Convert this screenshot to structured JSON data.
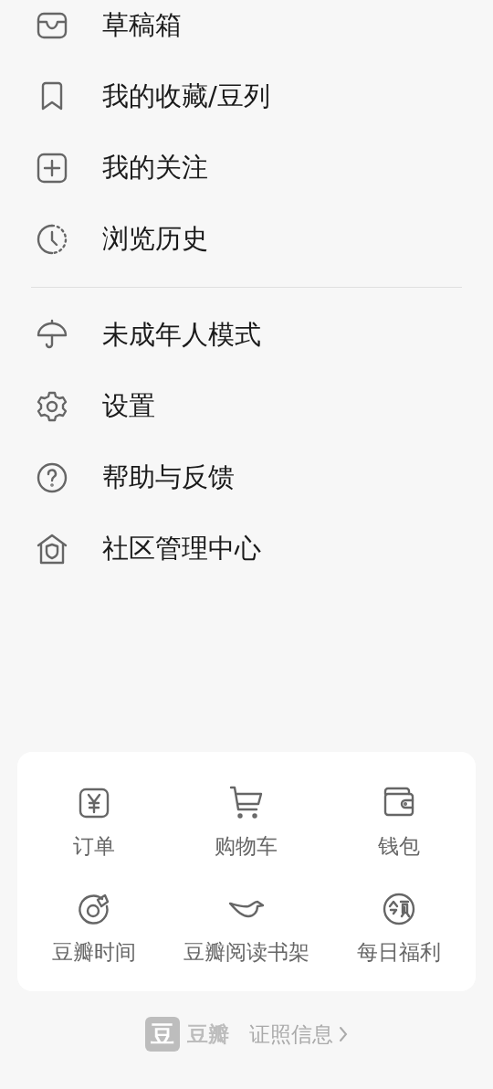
{
  "menu_groups": [
    {
      "items": [
        {
          "label": "草稿箱"
        },
        {
          "label": "我的收藏/豆列"
        },
        {
          "label": "我的关注"
        },
        {
          "label": "浏览历史"
        }
      ]
    },
    {
      "items": [
        {
          "label": "未成年人模式"
        },
        {
          "label": "设置"
        },
        {
          "label": "帮助与反馈"
        },
        {
          "label": "社区管理中心"
        }
      ]
    }
  ],
  "shortcuts": [
    {
      "label": "订单"
    },
    {
      "label": "购物车"
    },
    {
      "label": "钱包"
    },
    {
      "label": "豆瓣时间"
    },
    {
      "label": "豆瓣阅读书架"
    },
    {
      "label": "每日福利"
    }
  ],
  "footer": {
    "logo_mark": "豆",
    "brand": "豆瓣",
    "link": "证照信息"
  }
}
